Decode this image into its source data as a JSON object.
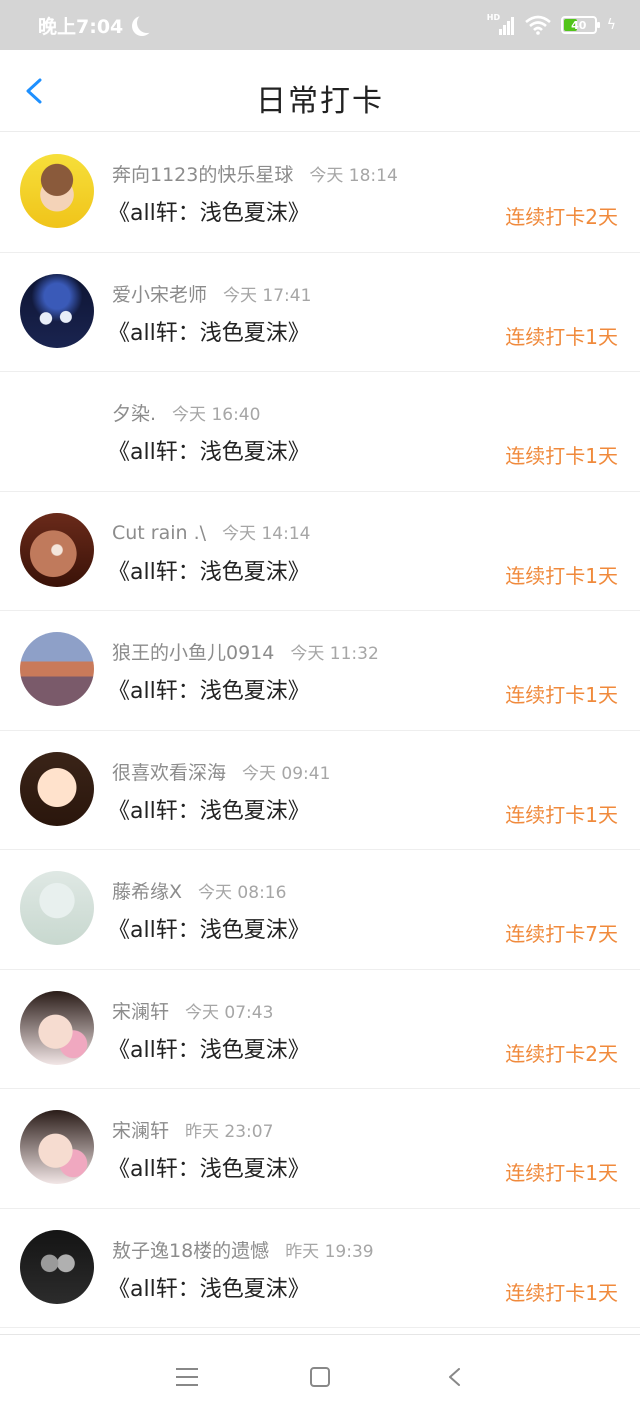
{
  "status": {
    "time": "晚上7:04",
    "battery": "40"
  },
  "header": {
    "title": "日常打卡"
  },
  "rows": [
    {
      "name": "奔向1123的快乐星球",
      "time": "今天 18:14",
      "book": "《all轩：浅色夏沫》",
      "streak": "连续打卡2天",
      "avatar": "a1"
    },
    {
      "name": "爱小宋老师",
      "time": "今天 17:41",
      "book": "《all轩：浅色夏沫》",
      "streak": "连续打卡1天",
      "avatar": "a2"
    },
    {
      "name": "夕染.",
      "time": "今天 16:40",
      "book": "《all轩：浅色夏沫》",
      "streak": "连续打卡1天",
      "avatar": "none"
    },
    {
      "name": "Cut rain .\\",
      "time": "今天 14:14",
      "book": "《all轩：浅色夏沫》",
      "streak": "连续打卡1天",
      "avatar": "a4"
    },
    {
      "name": "狼王的小鱼儿0914",
      "time": "今天 11:32",
      "book": "《all轩：浅色夏沫》",
      "streak": "连续打卡1天",
      "avatar": "a5"
    },
    {
      "name": "很喜欢看深海",
      "time": "今天 09:41",
      "book": "《all轩：浅色夏沫》",
      "streak": "连续打卡1天",
      "avatar": "a6"
    },
    {
      "name": "藤希缘X",
      "time": "今天 08:16",
      "book": "《all轩：浅色夏沫》",
      "streak": "连续打卡7天",
      "avatar": "a7"
    },
    {
      "name": "宋澜轩",
      "time": "今天 07:43",
      "book": "《all轩：浅色夏沫》",
      "streak": "连续打卡2天",
      "avatar": "a8"
    },
    {
      "name": "宋澜轩",
      "time": "昨天 23:07",
      "book": "《all轩：浅色夏沫》",
      "streak": "连续打卡1天",
      "avatar": "a8"
    },
    {
      "name": "敖子逸18楼的遗憾",
      "time": "昨天 19:39",
      "book": "《all轩：浅色夏沫》",
      "streak": "连续打卡1天",
      "avatar": "a10"
    }
  ],
  "avatar_styles": {
    "a1": "radial-gradient(circle at 50% 35%, #8a5a3b 0 26%, transparent 27%), radial-gradient(circle at 50% 55%, #f4d3b8 0 30%, transparent 31%), linear-gradient(#f6df3a, #f0c41a)",
    "a2": "radial-gradient(circle at 35% 60%, #e8eef8 0 9%, transparent 10%), radial-gradient(circle at 62% 58%, #e8eef8 0 9%, transparent 10%), radial-gradient(circle at 50% 30%, #3a5ab8 0 20%, transparent 40%), linear-gradient(#0d1432, #1a2450)",
    "a4": "radial-gradient(circle at 50% 50%, #f4e6dc 0 10%, transparent 12%), radial-gradient(circle at 45% 55%, #c07a5c 0 40%, transparent 41%), linear-gradient(#6a2a1a, #3a1208)",
    "a5": "linear-gradient(180deg, #8ea0c8 0 40%, #c97a5a 40% 60%, #7a5a6a 60% 100%)",
    "a6": "radial-gradient(circle at 50% 48%, #ffe2cc 0 36%, transparent 37%), linear-gradient(#3a2418, #2a160c)",
    "a7": "radial-gradient(circle at 50% 40%, #e8f0ee 0 30%, transparent 31%), linear-gradient(#dfe8e4, #c8d8cf)",
    "a8": "radial-gradient(circle at 48% 55%, #f6dcd0 0 30%, transparent 31%), radial-gradient(circle at 72% 72%, #f0a8c0 0 18%, transparent 19%), linear-gradient(#2a1c18, #f2e6e6)",
    "a10": "radial-gradient(circle at 40% 45%, #9a9a9a 0 14%, transparent 15%), radial-gradient(circle at 62% 45%, #b0b0b0 0 14%, transparent 15%), linear-gradient(#141414, #2c2c2c)"
  }
}
